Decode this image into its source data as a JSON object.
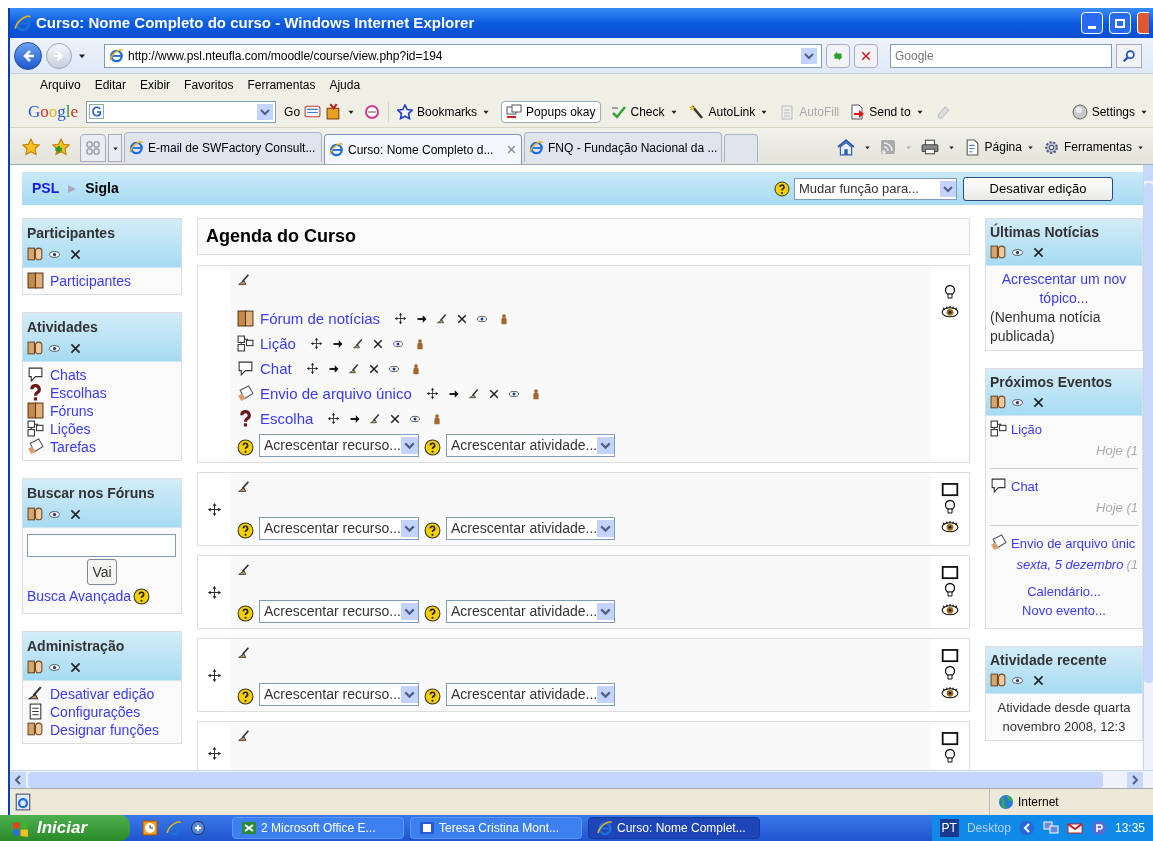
{
  "window": {
    "title": "Curso: Nome Completo do curso - Windows Internet Explorer"
  },
  "address_bar": {
    "url": "http://www.psl.nteufla.com/moodle/course/view.php?id=194"
  },
  "search_box": {
    "placeholder": "Google"
  },
  "menu": [
    "Arquivo",
    "Editar",
    "Exibir",
    "Favoritos",
    "Ferramentas",
    "Ajuda"
  ],
  "google_toolbar": {
    "logo": "Google",
    "go": "Go",
    "items": [
      {
        "label": "Bookmarks",
        "kind": "bookmarks",
        "dropdown": true,
        "disabled": false
      },
      {
        "label": "Popups okay",
        "kind": "popups",
        "dropdown": false,
        "disabled": false
      },
      {
        "label": "Check",
        "kind": "check",
        "dropdown": true,
        "disabled": false
      },
      {
        "label": "AutoLink",
        "kind": "autolink",
        "dropdown": true,
        "disabled": false
      },
      {
        "label": "AutoFill",
        "kind": "autofill",
        "dropdown": false,
        "disabled": true
      },
      {
        "label": "Send to",
        "kind": "sendto",
        "dropdown": true,
        "disabled": false
      }
    ],
    "settings": "Settings"
  },
  "tabs": [
    {
      "label": "E-mail de SWFactory Consult...",
      "selected": false
    },
    {
      "label": "Curso: Nome Completo d...",
      "selected": true
    },
    {
      "label": "FNQ - Fundação Nacional da ...",
      "selected": false
    }
  ],
  "command_bar": [
    {
      "label": "Página",
      "kind": "page"
    },
    {
      "label": "Ferramentas",
      "kind": "tools"
    }
  ],
  "breadcrumb": [
    "PSL",
    "Sigla"
  ],
  "role_select": {
    "value": "Mudar função para..."
  },
  "edit_button": "Desativar edição",
  "left_blocks": [
    {
      "title": "Participantes",
      "kind": "links",
      "items": [
        {
          "label": "Participantes",
          "kind": "forum"
        }
      ]
    },
    {
      "title": "Atividades",
      "kind": "links",
      "items": [
        {
          "label": "Chats",
          "kind": "chat"
        },
        {
          "label": "Escolhas",
          "kind": "choice"
        },
        {
          "label": "Fóruns",
          "kind": "forum"
        },
        {
          "label": "Lições",
          "kind": "lesson"
        },
        {
          "label": "Tarefas",
          "kind": "assignment"
        }
      ]
    },
    {
      "title": "Buscar nos Fóruns",
      "kind": "search",
      "button": "Vai",
      "link": "Busca Avançada"
    },
    {
      "title": "Administração",
      "kind": "links",
      "items": [
        {
          "label": "Desativar edição",
          "kind": "edit"
        },
        {
          "label": "Configurações",
          "kind": "settings"
        },
        {
          "label": "Designar funções",
          "kind": "roles"
        }
      ]
    }
  ],
  "course": {
    "heading": "Agenda do Curso",
    "sections": [
      {
        "kind": "general",
        "activities": [
          {
            "label": "Fórum de notícias",
            "kind": "forum"
          },
          {
            "label": "Lição",
            "kind": "lesson"
          },
          {
            "label": "Chat",
            "kind": "chat"
          },
          {
            "label": "Envio de arquivo único",
            "kind": "assignment"
          },
          {
            "label": "Escolha",
            "kind": "choice"
          }
        ],
        "add_resource": "Acrescentar recurso...",
        "add_activity": "Acrescentar atividade..."
      },
      {
        "kind": "topic",
        "add_resource": "Acrescentar recurso...",
        "add_activity": "Acrescentar atividade..."
      },
      {
        "kind": "topic",
        "add_resource": "Acrescentar recurso...",
        "add_activity": "Acrescentar atividade..."
      },
      {
        "kind": "topic",
        "add_resource": "Acrescentar recurso...",
        "add_activity": "Acrescentar atividade..."
      },
      {
        "kind": "topic"
      }
    ]
  },
  "right_blocks": [
    {
      "title": "Últimas Notícias",
      "kind": "news",
      "link_lines": [
        "Acrescentar um nov",
        "tópico..."
      ],
      "note": "(Nenhuma notícia publicada)"
    },
    {
      "title": "Próximos Eventos",
      "kind": "events",
      "events": [
        {
          "label": "Lição",
          "kind": "lesson",
          "date": "Hoje (1"
        },
        {
          "label": "Chat",
          "kind": "chat",
          "date": "Hoje (1"
        },
        {
          "label": "Envio de arquivo únic",
          "kind": "assignment",
          "date_link": "sexta, 5 dezembro",
          "date": "(1"
        }
      ],
      "links": [
        "Calendário...",
        "Novo evento..."
      ]
    },
    {
      "title": "Atividade recente",
      "kind": "recent",
      "lines": [
        "Atividade desde quarta",
        "novembro 2008, 12:3"
      ]
    }
  ],
  "status_bar": {
    "zone": "Internet"
  },
  "taskbar": {
    "start": "Iniciar",
    "tasks": [
      {
        "label": "2 Microsoft Office E...",
        "kind": "excel",
        "selected": false
      },
      {
        "label": "Teresa Cristina Mont...",
        "kind": "word",
        "selected": false
      },
      {
        "label": "Curso: Nome Complet...",
        "kind": "ie",
        "selected": true
      }
    ],
    "language": "PT",
    "desktop": "Desktop",
    "clock": "13:35"
  }
}
